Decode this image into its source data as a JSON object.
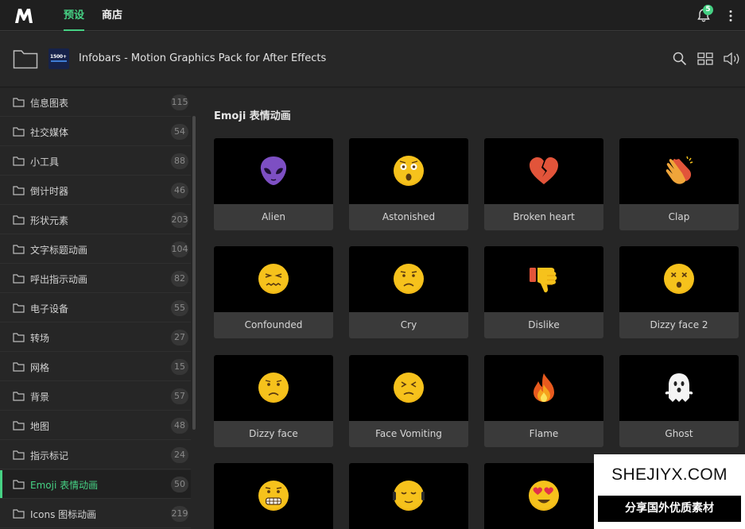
{
  "topbar": {
    "tab_presets": "预设",
    "tab_store": "商店",
    "notifications_count": "5"
  },
  "pack": {
    "title": "Infobars - Motion Graphics Pack for After Effects",
    "thumb_text": "1500+"
  },
  "sidebar": {
    "items": [
      {
        "label": "信息图表",
        "count": "115"
      },
      {
        "label": "社交媒体",
        "count": "54"
      },
      {
        "label": "小工具",
        "count": "88"
      },
      {
        "label": "倒计时器",
        "count": "46"
      },
      {
        "label": "形状元素",
        "count": "203"
      },
      {
        "label": "文字标题动画",
        "count": "104"
      },
      {
        "label": "呼出指示动画",
        "count": "82"
      },
      {
        "label": "电子设备",
        "count": "55"
      },
      {
        "label": "转场",
        "count": "27"
      },
      {
        "label": "网格",
        "count": "15"
      },
      {
        "label": "背景",
        "count": "57"
      },
      {
        "label": "地图",
        "count": "48"
      },
      {
        "label": "指示标记",
        "count": "24"
      },
      {
        "label": "Emoji 表情动画",
        "count": "50",
        "active": true
      },
      {
        "label": "Icons 图标动画",
        "count": "219"
      }
    ]
  },
  "main": {
    "section_title": "Emoji 表情动画",
    "cards": [
      {
        "name": "Alien",
        "icon": "alien-icon"
      },
      {
        "name": "Astonished",
        "icon": "astonished-face-icon"
      },
      {
        "name": "Broken heart",
        "icon": "broken-heart-icon"
      },
      {
        "name": "Clap",
        "icon": "clap-icon"
      },
      {
        "name": "Confounded",
        "icon": "confounded-face-icon"
      },
      {
        "name": "Cry",
        "icon": "cry-face-icon"
      },
      {
        "name": "Dislike",
        "icon": "thumbs-down-icon"
      },
      {
        "name": "Dizzy face 2",
        "icon": "dizzy-face-icon"
      },
      {
        "name": "Dizzy face",
        "icon": "frowning-face-icon"
      },
      {
        "name": "Face Vomiting",
        "icon": "squint-face-icon"
      },
      {
        "name": "Flame",
        "icon": "flame-icon"
      },
      {
        "name": "Ghost",
        "icon": "ghost-icon"
      },
      {
        "name": "",
        "icon": "grimace-face-icon"
      },
      {
        "name": "",
        "icon": "headphones-face-icon"
      },
      {
        "name": "",
        "icon": "heart-eyes-face-icon"
      }
    ]
  },
  "watermark": {
    "site": "SHEJIYX.COM",
    "tagline": "分享国外优质素材"
  },
  "colors": {
    "accent": "#46d184",
    "emoji_yellow": "#f6c21c",
    "alien_purple": "#7d4fc3"
  }
}
